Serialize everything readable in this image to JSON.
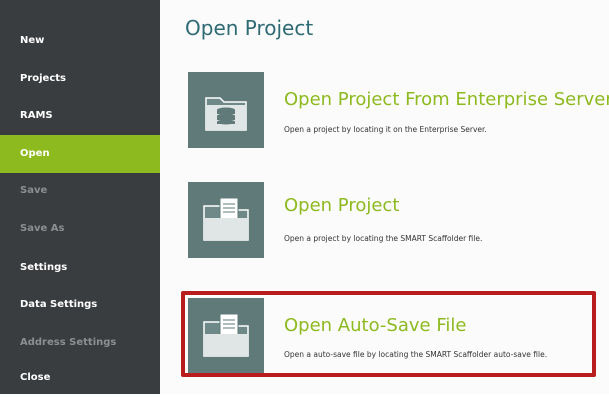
{
  "sidebar": {
    "items": [
      {
        "label": "New",
        "state": "normal"
      },
      {
        "label": "Projects",
        "state": "normal"
      },
      {
        "label": "RAMS",
        "state": "normal"
      },
      {
        "label": "Open",
        "state": "active"
      },
      {
        "label": "Save",
        "state": "disabled"
      },
      {
        "label": "Save As",
        "state": "disabled"
      },
      {
        "label": "Settings",
        "state": "normal"
      },
      {
        "label": "Data Settings",
        "state": "normal"
      },
      {
        "label": "Address Settings",
        "state": "disabled"
      },
      {
        "label": "Close",
        "state": "normal"
      }
    ]
  },
  "main": {
    "title": "Open Project",
    "options": [
      {
        "icon": "server-folder-icon",
        "title": "Open Project From Enterprise Server",
        "description": "Open a project by locating it on the Enterprise Server."
      },
      {
        "icon": "document-folder-icon",
        "title": "Open Project",
        "description": "Open a project by locating the SMART Scaffolder file."
      },
      {
        "icon": "document-folder-icon",
        "title": "Open Auto-Save File",
        "description": "Open a auto-save file by locating the SMART Scaffolder auto-save file.",
        "highlighted": true
      }
    ]
  },
  "colors": {
    "sidebar_bg": "#3a3d3f",
    "accent_green": "#8dba1f",
    "title_teal": "#2e6a74",
    "tile_bg": "#5f7a79",
    "highlight_red": "#b81c1c"
  }
}
